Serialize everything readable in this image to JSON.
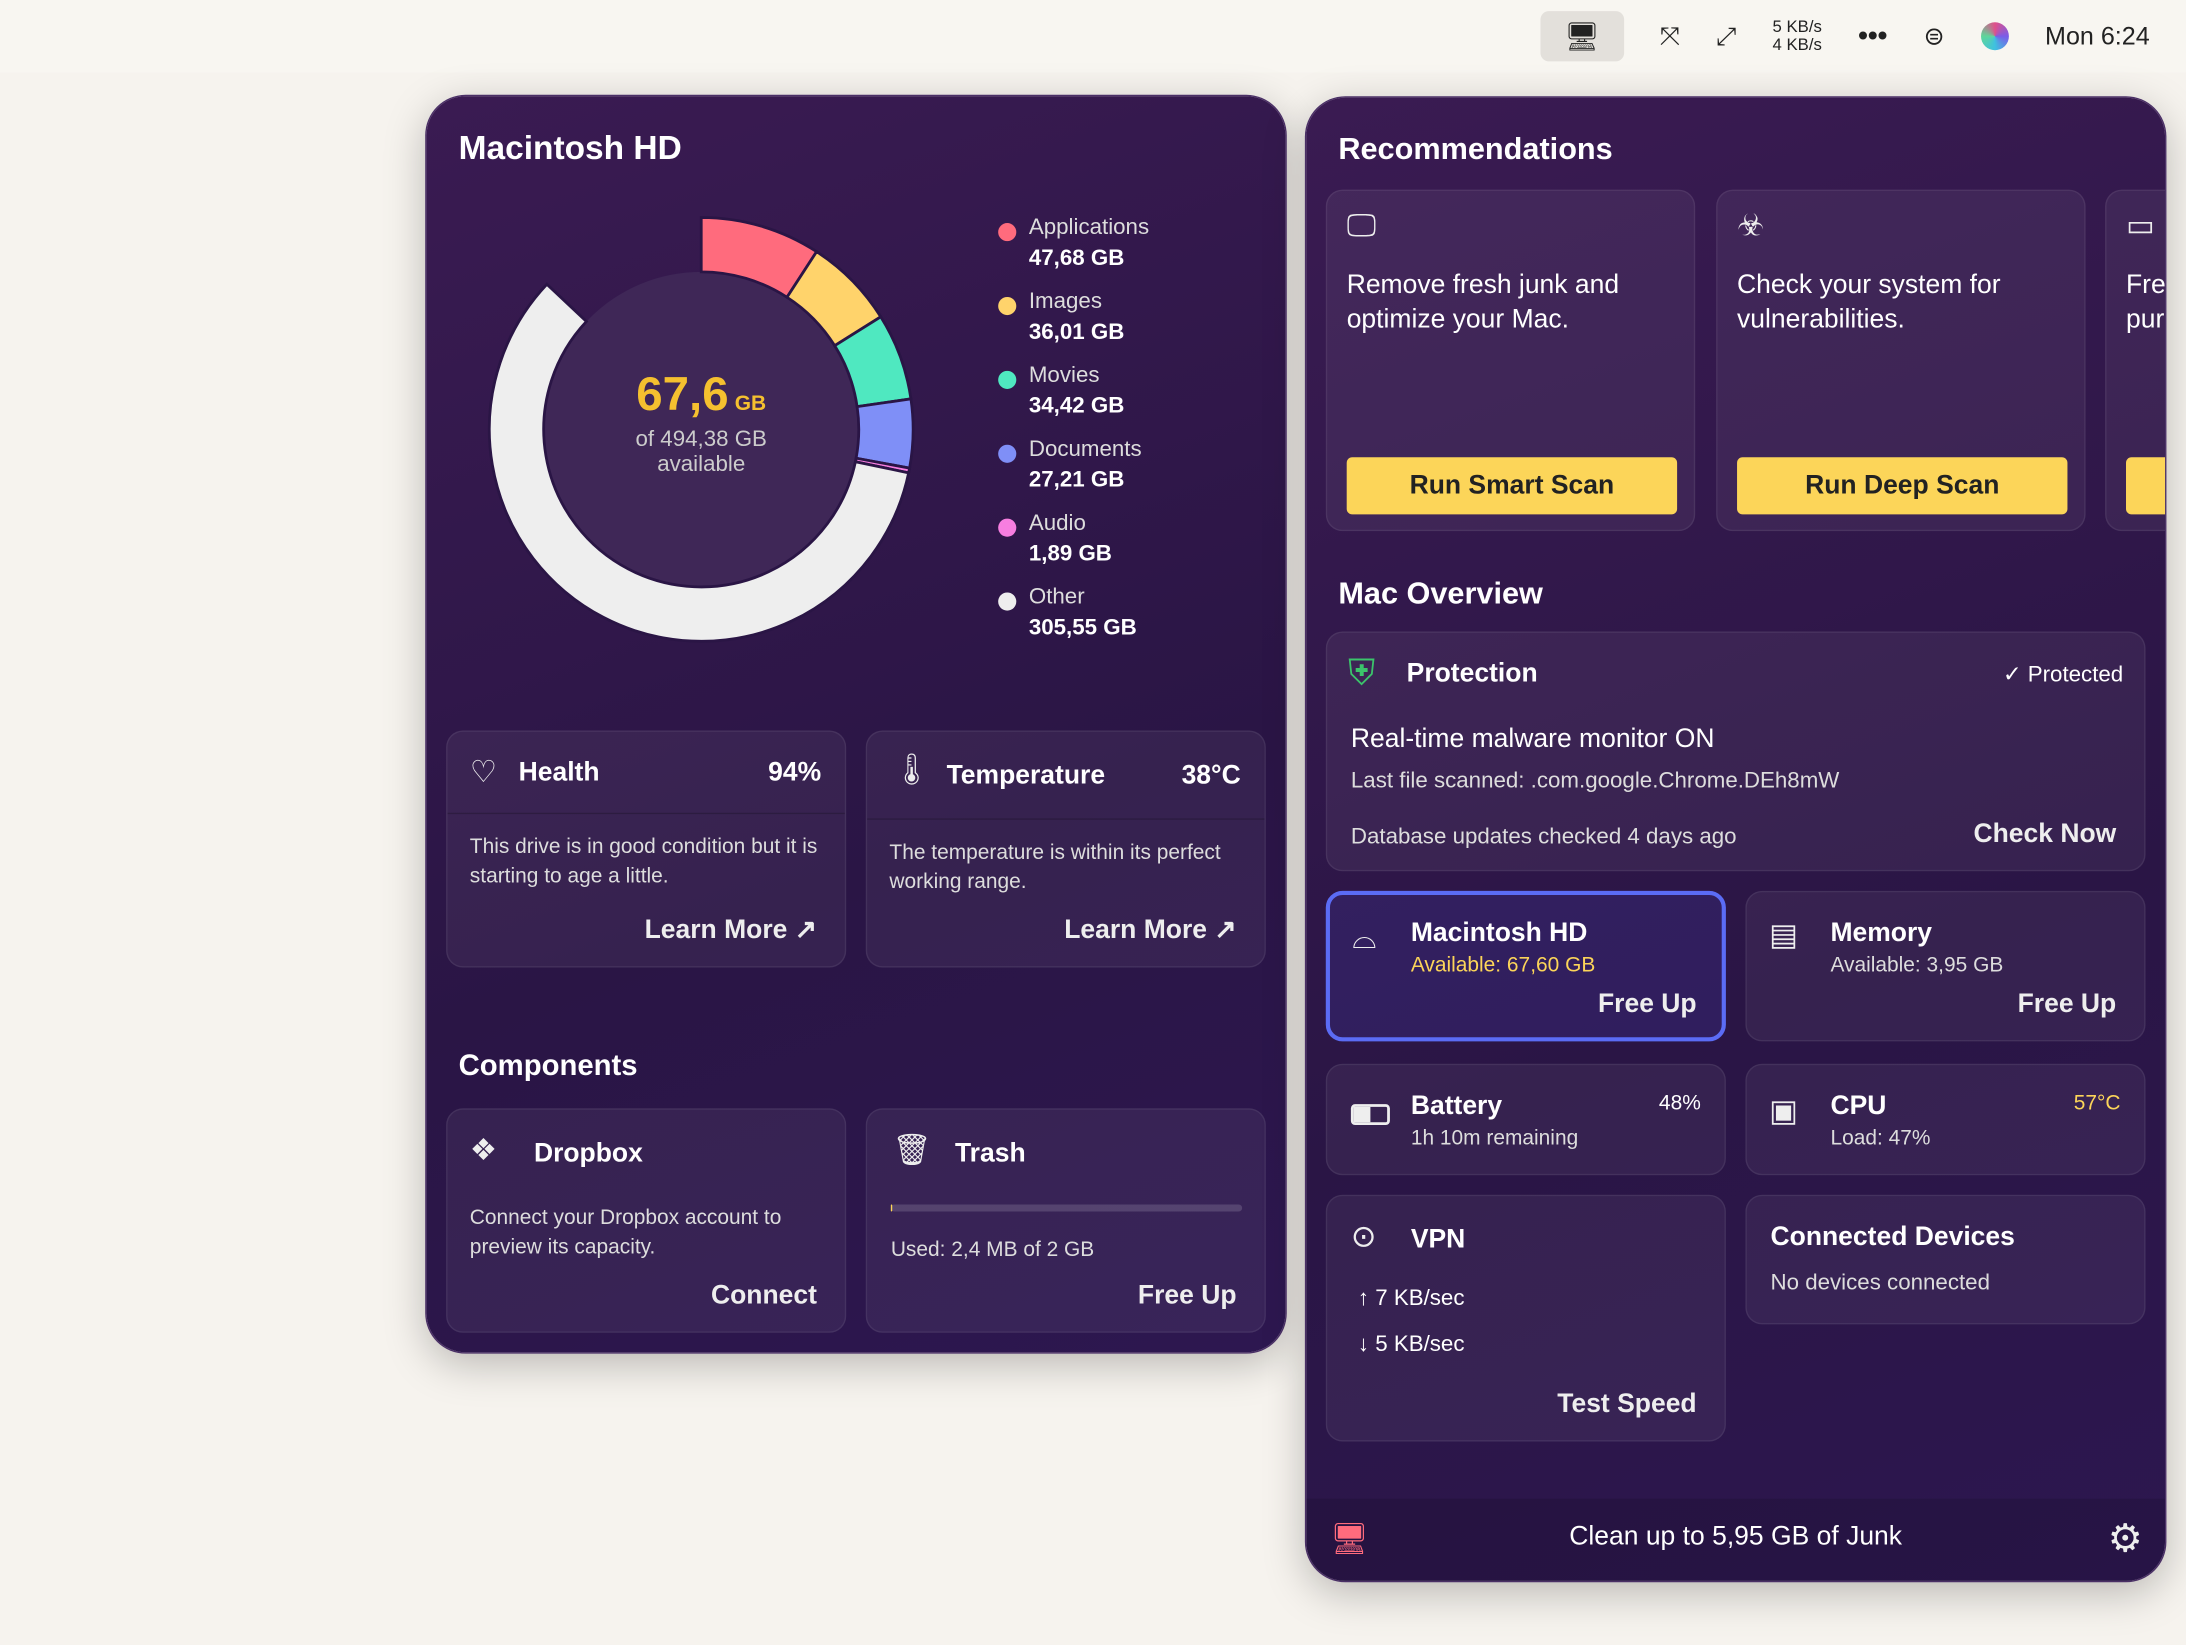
{
  "menubar": {
    "net_up": "5 KB/s",
    "net_down": "4 KB/s",
    "clock": "Mon 6:24",
    "icons": [
      "cleanmymac-flag-icon",
      "move-icon",
      "expand-icon",
      "more-icon",
      "control-center-icon",
      "siri-icon"
    ]
  },
  "left": {
    "title": "Macintosh HD",
    "donut": {
      "free_value": "67,6",
      "free_unit": "GB",
      "of_text": "of 494,38 GB",
      "available": "available"
    },
    "chart_data": {
      "type": "pie",
      "total_gb": 494.38,
      "free_gb": 67.6,
      "categories": [
        "Applications",
        "Images",
        "Movies",
        "Documents",
        "Audio",
        "Other"
      ],
      "values_text": [
        "47,68 GB",
        "36,01 GB",
        "34,42 GB",
        "27,21 GB",
        "1,89 GB",
        "305,55 GB"
      ],
      "values": [
        47.68,
        36.01,
        34.42,
        27.21,
        1.89,
        305.55
      ],
      "colors": [
        "#ff6b7d",
        "#ffd36b",
        "#4fe8c0",
        "#7f8ff7",
        "#f77ee0",
        "#eeeeee"
      ]
    },
    "health": {
      "title": "Health",
      "value": "94%",
      "text": "This drive is in good condition but it is starting to age a little.",
      "link": "Learn More ↗"
    },
    "temperature": {
      "title": "Temperature",
      "value": "38°C",
      "text": "The temperature is within its perfect working range.",
      "link": "Learn More ↗"
    },
    "components_title": "Components",
    "dropbox": {
      "title": "Dropbox",
      "text": "Connect your Dropbox account to preview its capacity.",
      "action": "Connect"
    },
    "trash": {
      "title": "Trash",
      "used": "Used: 2,4 MB of 2 GB",
      "progress": 0.0012,
      "action": "Free Up"
    }
  },
  "right": {
    "rec_title": "Recommendations",
    "recs": [
      {
        "text": "Remove fresh junk and optimize your Mac.",
        "button": "Run Smart Scan"
      },
      {
        "text": "Check your system for vulnerabilities.",
        "button": "Run Deep Scan"
      },
      {
        "text": "Fre pur",
        "button": ""
      }
    ],
    "overview_title": "Mac Overview",
    "protection": {
      "title": "Protection",
      "status": "Protected",
      "monitor": "Real-time malware monitor ON",
      "last": "Last file scanned: .com.google.Chrome.DEh8mW",
      "db": "Database updates checked 4 days ago",
      "action": "Check Now"
    },
    "disk": {
      "title": "Macintosh HD",
      "sub": "Available: 67,60 GB",
      "action": "Free Up"
    },
    "memory": {
      "title": "Memory",
      "sub": "Available: 3,95 GB",
      "action": "Free Up"
    },
    "battery": {
      "title": "Battery",
      "value": "48%",
      "sub": "1h 10m remaining",
      "level": 0.48
    },
    "cpu": {
      "title": "CPU",
      "value": "57°C",
      "sub": "Load: 47%"
    },
    "vpn": {
      "title": "VPN",
      "up": "7 KB/sec",
      "down": "5 KB/sec",
      "action": "Test Speed"
    },
    "devices": {
      "title": "Connected Devices",
      "sub": "No devices connected"
    },
    "footer": {
      "text": "Clean up to 5,95 GB of Junk"
    },
    "colors": {
      "accent": "#fcd559",
      "selected_border": "#5b6cf5",
      "cpu_temp": "#fcd559"
    }
  }
}
